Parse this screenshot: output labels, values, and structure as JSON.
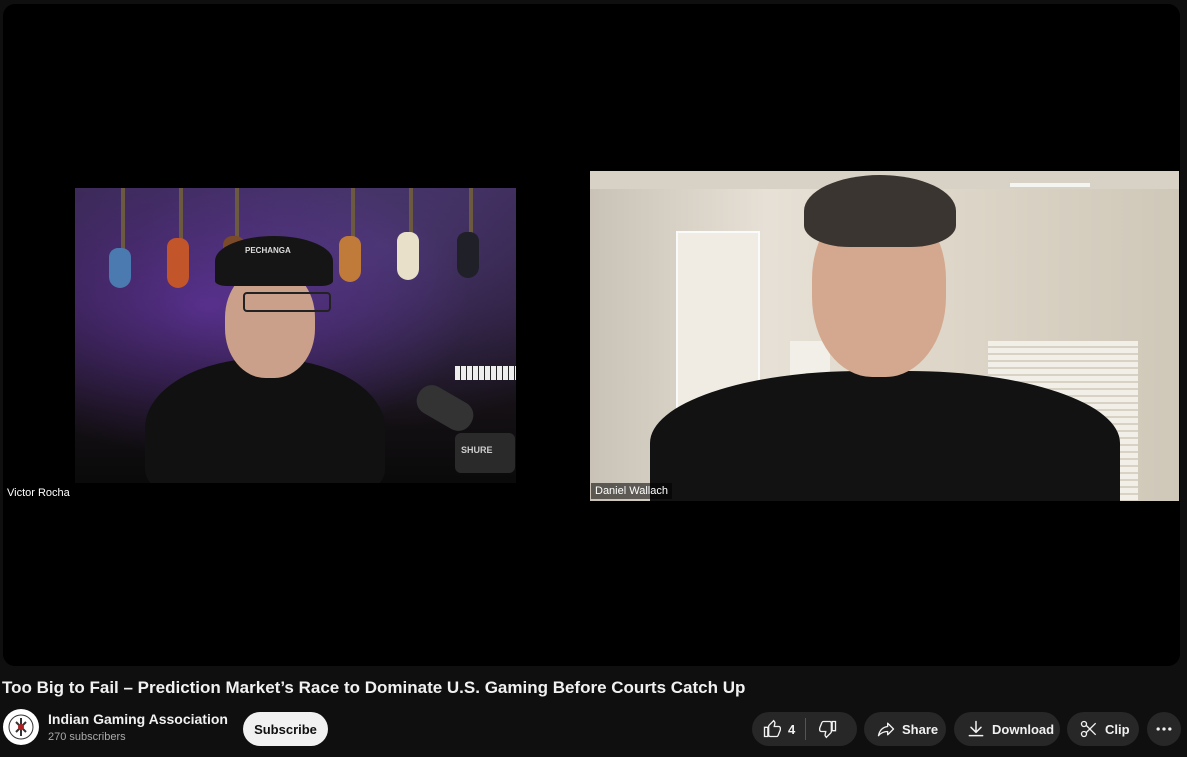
{
  "video": {
    "participants": [
      {
        "name": "Victor Rocha"
      },
      {
        "name": "Daniel Wallach"
      }
    ],
    "cap_text": "PECHANGA",
    "mic_brand": "SHURE"
  },
  "title": "Too Big to Fail – Prediction Market’s Race to Dominate U.S. Gaming Before Courts Catch Up",
  "channel": {
    "name": "Indian Gaming Association",
    "subscribers": "270 subscribers",
    "subscribe_label": "Subscribe"
  },
  "actions": {
    "like_count": "4",
    "share_label": "Share",
    "download_label": "Download",
    "clip_label": "Clip"
  }
}
